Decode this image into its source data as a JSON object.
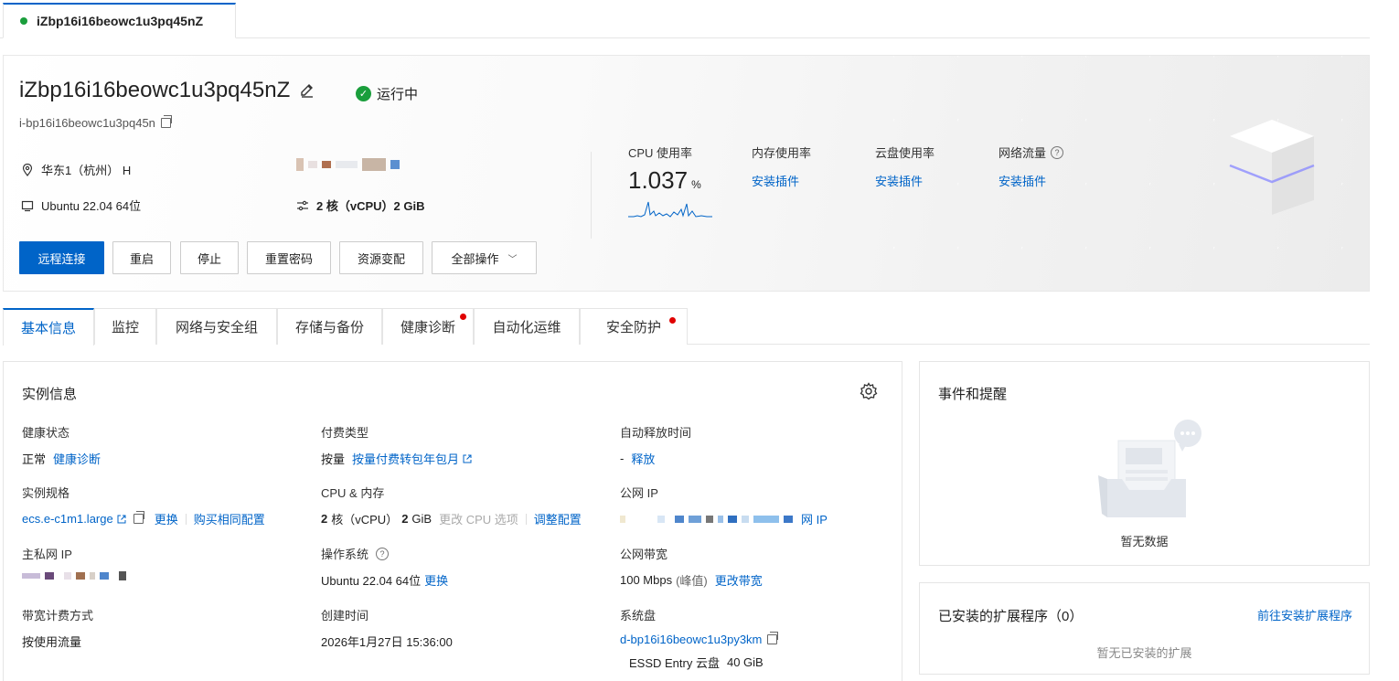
{
  "top_tab": {
    "label": "iZbp16i16beowc1u3pq45nZ"
  },
  "header": {
    "name": "iZbp16i16beowc1u3pq45nZ",
    "status": "运行中",
    "instance_id": "i-bp16i16beowc1u3pq45n",
    "region": "华东1（杭州） H",
    "os": "Ubuntu 22.04 64位",
    "spec_cores": "2 核（vCPU）2 GiB",
    "buttons": {
      "remote": "远程连接",
      "restart": "重启",
      "stop": "停止",
      "reset_pw": "重置密码",
      "resize": "资源变配",
      "all_ops": "全部操作"
    },
    "metrics": {
      "cpu_label": "CPU 使用率",
      "cpu_value": "1.037",
      "cpu_unit": "%",
      "mem_label": "内存使用率",
      "mem_link": "安装插件",
      "disk_label": "云盘使用率",
      "disk_link": "安装插件",
      "net_label": "网络流量",
      "net_link": "安装插件"
    },
    "colors": {
      "primary": "#0064c8",
      "running": "#1a9e3c"
    }
  },
  "tabs": [
    {
      "label": "基本信息"
    },
    {
      "label": "监控"
    },
    {
      "label": "网络与安全组"
    },
    {
      "label": "存储与备份"
    },
    {
      "label": "健康诊断"
    },
    {
      "label": "自动化运维"
    },
    {
      "label": "安全防护"
    }
  ],
  "instance_info": {
    "title": "实例信息",
    "health_k": "健康状态",
    "health_v": "正常",
    "health_link": "健康诊断",
    "billing_k": "付费类型",
    "billing_v": "按量",
    "billing_link": "按量付费转包年包月",
    "release_k": "自动释放时间",
    "release_v": "-",
    "release_link": "释放",
    "spec_k": "实例规格",
    "spec_v": "ecs.e-c1m1.large",
    "spec_change": "更换",
    "spec_buy": "购买相同配置",
    "cpu_k": "CPU & 内存",
    "cpu_v1": "2",
    "cpu_v2": "核（vCPU）",
    "cpu_v3": "2",
    "cpu_v4": "GiB",
    "cpu_muted": "更改 CPU 选项",
    "cpu_adjust": "调整配置",
    "pubip_k": "公网 IP",
    "pubip_tail": "网 IP",
    "privip_k": "主私网 IP",
    "os_k": "操作系统",
    "os_v": "Ubuntu 22.04 64位",
    "os_link": "更换",
    "bw_k": "公网带宽",
    "bw_v": "100 Mbps",
    "bw_peak": "(峰值)",
    "bw_link": "更改带宽",
    "bwbill_k": "带宽计费方式",
    "bwbill_v": "按使用流量",
    "created_k": "创建时间",
    "created_v": "2026年1月27日 15:36:00",
    "sysdisk_k": "系统盘",
    "sysdisk_v": "d-bp16i16beowc1u3py3km",
    "sysdisk_type": "ESSD Entry 云盘",
    "sysdisk_size": "40 GiB"
  },
  "events": {
    "title": "事件和提醒",
    "empty": "暂无数据"
  },
  "extensions": {
    "title": "已安装的扩展程序（0）",
    "link": "前往安装扩展程序",
    "empty": "暂无已安装的扩展"
  }
}
